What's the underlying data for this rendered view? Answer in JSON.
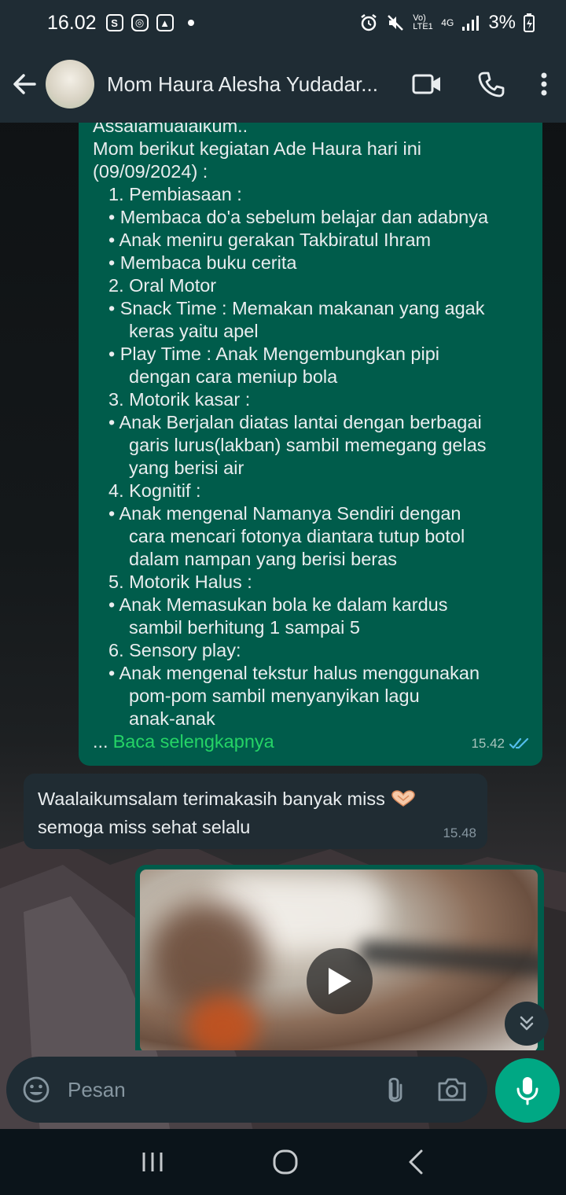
{
  "status_bar": {
    "time": "16.02",
    "left_icons": [
      "shopping-bag-icon",
      "instagram-icon",
      "image-icon"
    ],
    "network_label": "Vo) LTE1",
    "network_type": "4G",
    "battery": "3%"
  },
  "header": {
    "contact_name": "Mom Haura Alesha Yudadar...",
    "icons": [
      "back-arrow-icon",
      "video-call-icon",
      "voice-call-icon",
      "more-options-icon"
    ]
  },
  "messages": {
    "outgoing": {
      "lines": [
        "Assalamualaikum..",
        "Mom berikut kegiatan Ade Haura hari ini",
        "(09/09/2024) :",
        "1. Pembiasaan :",
        "•  Membaca do'a sebelum belajar dan adabnya",
        "•  Anak meniru gerakan Takbiratul Ihram",
        "•  Membaca buku cerita",
        "2. Oral Motor",
        "•  Snack Time : Memakan makanan yang agak",
        "keras yaitu apel",
        "•  Play Time : Anak Mengembungkan pipi",
        "dengan cara meniup bola",
        "3. Motorik kasar :",
        "•  Anak Berjalan diatas lantai dengan berbagai",
        "garis lurus(lakban) sambil memegang gelas",
        "yang berisi air",
        "4. Kognitif :",
        "•  Anak mengenal Namanya Sendiri dengan",
        "cara mencari fotonya diantara tutup botol",
        "dalam nampan yang berisi beras",
        "5. Motorik Halus :",
        "•  Anak Memasukan bola ke dalam kardus",
        "sambil berhitung 1 sampai 5",
        "6. Sensory play:",
        "•  Anak mengenal tekstur halus menggunakan",
        "pom-pom sambil menyanyikan lagu",
        "anak-anak"
      ],
      "ellipsis": "...",
      "read_more": "Baca selengkapnya",
      "time": "15.42"
    },
    "incoming": {
      "text_1": "Waalaikumsalam terimakasih banyak miss",
      "text_2": "semoga miss sehat selalu",
      "time": "15.48"
    }
  },
  "input": {
    "placeholder": "Pesan"
  },
  "colors": {
    "outgoing_bubble": "#005c4b",
    "incoming_bubble": "#202c33",
    "accent_green": "#25d366",
    "mic_button": "#00a884",
    "header_bg": "#1f2c34"
  }
}
